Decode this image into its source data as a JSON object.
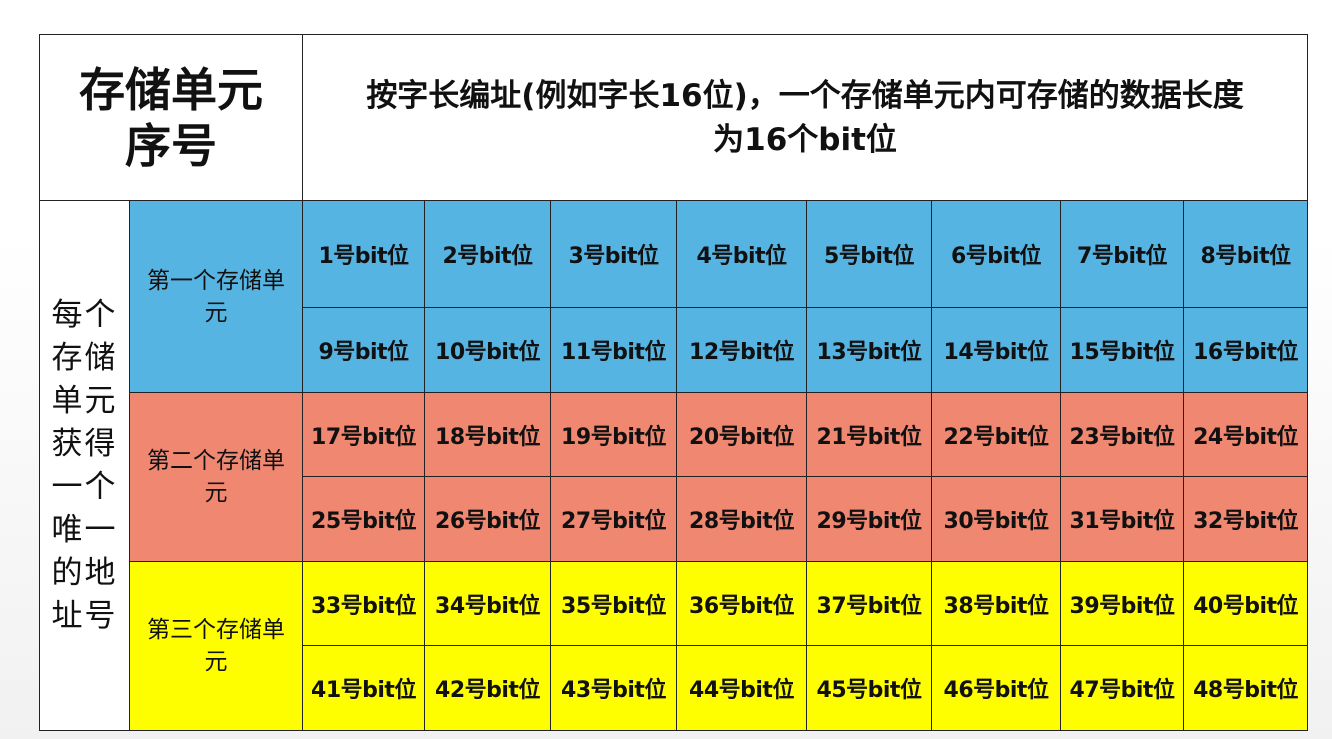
{
  "header": {
    "corner_line1": "存储单元",
    "corner_line2": "序号",
    "description_line1": "按字长编址(例如字长16位)，一个存储单元内可存储的数据长度",
    "description_line2": "为16个bit位"
  },
  "side_label": [
    "每个",
    "存储",
    "单元",
    "获得",
    "一个",
    "唯一",
    "的地",
    "址号"
  ],
  "groups": [
    {
      "label_line1": "第一个存储单",
      "label_line2": "元",
      "color": "#56b4e3"
    },
    {
      "label_line1": "第二个存储单",
      "label_line2": "元",
      "color": "#ef8771"
    },
    {
      "label_line1": "第三个存储单",
      "label_line2": "元",
      "color": "#fefe00"
    }
  ],
  "bit_rows": [
    [
      "1号bit位",
      "2号bit位",
      "3号bit位",
      "4号bit位",
      "5号bit位",
      "6号bit位",
      "7号bit位",
      "8号bit位"
    ],
    [
      "9号bit位",
      "10号bit位",
      "11号bit位",
      "12号bit位",
      "13号bit位",
      "14号bit位",
      "15号bit位",
      "16号bit位"
    ],
    [
      "17号bit位",
      "18号bit位",
      "19号bit位",
      "20号bit位",
      "21号bit位",
      "22号bit位",
      "23号bit位",
      "24号bit位"
    ],
    [
      "25号bit位",
      "26号bit位",
      "27号bit位",
      "28号bit位",
      "29号bit位",
      "30号bit位",
      "31号bit位",
      "32号bit位"
    ],
    [
      "33号bit位",
      "34号bit位",
      "35号bit位",
      "36号bit位",
      "37号bit位",
      "38号bit位",
      "39号bit位",
      "40号bit位"
    ],
    [
      "41号bit位",
      "42号bit位",
      "43号bit位",
      "44号bit位",
      "45号bit位",
      "46号bit位",
      "47号bit位",
      "48号bit位"
    ]
  ]
}
